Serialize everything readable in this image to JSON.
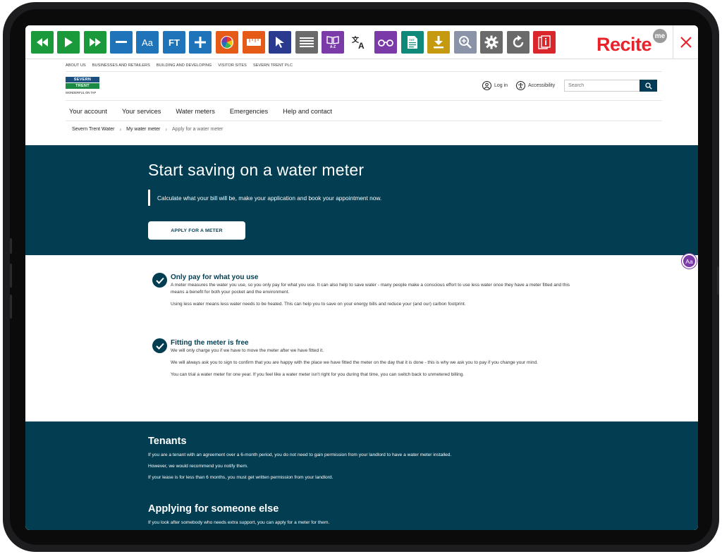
{
  "toolbar": {
    "buttons": [
      {
        "icon": "rewind-icon",
        "color": "#1a9a3a"
      },
      {
        "icon": "play-icon",
        "color": "#1a9a3a"
      },
      {
        "icon": "fast-forward-icon",
        "color": "#1a9a3a"
      },
      {
        "icon": "minus-icon",
        "color": "#1f73b8"
      },
      {
        "icon": "font-size-icon",
        "label": "Aa",
        "color": "#1f73b8"
      },
      {
        "icon": "font-type-icon",
        "label": "FT",
        "color": "#1f73b8"
      },
      {
        "icon": "plus-icon",
        "color": "#1f73b8"
      },
      {
        "icon": "color-wheel-icon",
        "color": "#e65a18"
      },
      {
        "icon": "ruler-icon",
        "color": "#e65a18"
      },
      {
        "icon": "cursor-icon",
        "color": "#2a3b8f"
      },
      {
        "icon": "text-only-icon",
        "color": "#6a6a6a"
      },
      {
        "icon": "dictionary-icon",
        "label": "A-Z",
        "color": "#7a3aa8"
      },
      {
        "icon": "translate-icon",
        "color": "#7a3aa8"
      },
      {
        "icon": "glasses-icon",
        "color": "#7a3aa8"
      },
      {
        "icon": "text-file-icon",
        "label": "TXT",
        "color": "#0f8a7a"
      },
      {
        "icon": "download-icon",
        "color": "#c59a10"
      },
      {
        "icon": "magnifier-icon",
        "color": "#8a93a8"
      },
      {
        "icon": "settings-icon",
        "color": "#6a6a6a"
      },
      {
        "icon": "reset-icon",
        "color": "#6a6a6a"
      },
      {
        "icon": "info-icon",
        "color": "#d8262b"
      }
    ],
    "brand": "Recite",
    "brand_badge": "me",
    "brand_color": "#e8212a"
  },
  "utility_nav": [
    "ABOUT US",
    "BUSINESSES AND RETAILERS",
    "BUILDING AND DEVELOPING",
    "VISITOR SITES",
    "SEVERN TRENT PLC"
  ],
  "logo": {
    "line1": "SEVERN",
    "line2": "TRENT",
    "tagline": "WONDERFUL ON TAP"
  },
  "header": {
    "login": "Log in",
    "accessibility": "Accessibility",
    "search_placeholder": "Search"
  },
  "main_nav": [
    "Your account",
    "Your services",
    "Water meters",
    "Emergencies",
    "Help and contact"
  ],
  "breadcrumb": [
    "Severn Trent Water",
    "My water meter",
    "Apply for a water meter"
  ],
  "hero": {
    "title": "Start saving on a water meter",
    "subtitle": "Calculate what your bill will be, make your application and book your appointment now.",
    "cta": "APPLY FOR A METER"
  },
  "features": [
    {
      "title": "Only pay for what you use",
      "paragraphs": [
        "A meter measures the water you use, so you only pay for what you use. It can also help to save water - many people make a conscious effort to use less water once they have a meter fitted and this means a benefit for both your pocket and the environment.",
        "Using less water means less water needs to be heated. This can help you to save on your energy bills and reduce your (and our) carbon footprint."
      ]
    },
    {
      "title": "Fitting the meter is free",
      "paragraphs": [
        "We will only charge you if  we have to move the meter after we have fitted it.",
        "We will always ask you to sign to confirm that you are happy with the place we have fitted the meter on the day that it is done - this is why we ask you to pay if you change your mind.",
        "You can trial a water meter for one year. If you feel like a water meter isn't right for you during that time, you can switch back to unmetered billing."
      ]
    }
  ],
  "floating_button": "Aa",
  "tenants": {
    "title": "Tenants",
    "paragraphs": [
      "If you are a tenant with an agreement over a 6-month period, you do not need to gain permission from your landlord to have a water meter installed.",
      "However, we would recommend you notify them.",
      "If your lease is for less than 6 months, you must get written permission from your landlord."
    ]
  },
  "someone_else": {
    "title": "Applying for someone else",
    "paragraphs": [
      "If you look after somebody who needs extra support, you can apply for a meter for them."
    ]
  },
  "colors": {
    "primary": "#023d51",
    "accent": "#7a3aa8"
  }
}
